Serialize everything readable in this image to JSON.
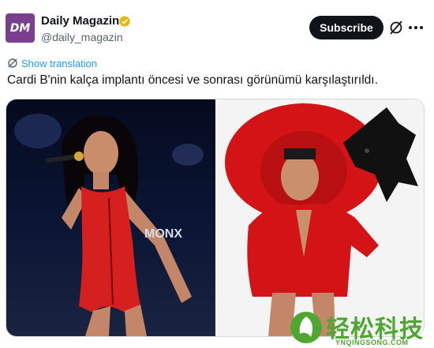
{
  "account": {
    "avatar_text": "DM",
    "name": "Daily Magazin",
    "handle": "@daily_magazin",
    "verified": true
  },
  "actions": {
    "subscribe_label": "Subscribe",
    "grok_icon": "grok-icon",
    "more_icon": "more-icon"
  },
  "tweet": {
    "translate_label": "Show translation",
    "text": "Cardi B'nin kalça implantı öncesi ve sonrası görünümü karşılaştırıldı."
  },
  "media": {
    "photo_left_overlay": "MONX"
  },
  "watermark": {
    "text_cn": "轻松科技",
    "text_en": "YNQINGSONG.COM"
  },
  "colors": {
    "accent_blue": "#1d9bf0",
    "verified_gold": "#e2b719",
    "watermark_green": "#4fa630",
    "avatar_purple": "#7a3f8f"
  }
}
